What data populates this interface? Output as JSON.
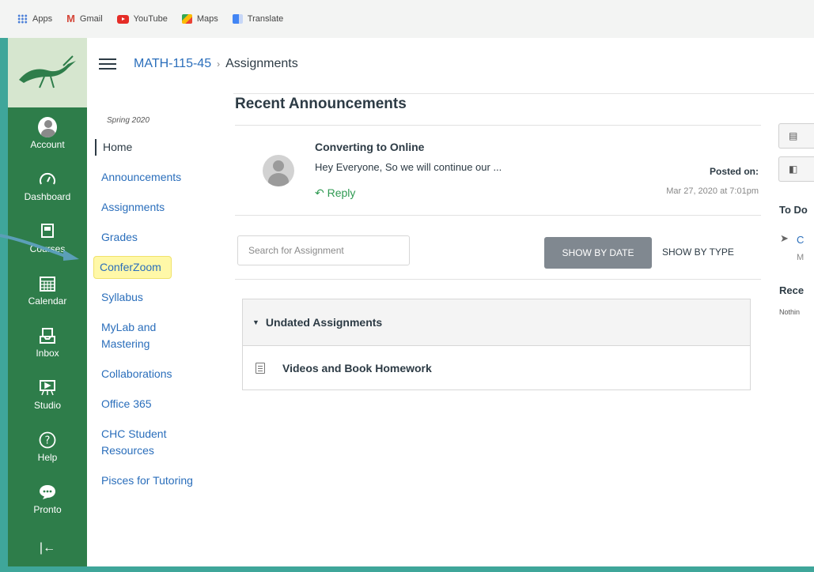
{
  "bookmarks": {
    "items": [
      {
        "label": "Apps",
        "icon": "apps-grid-icon"
      },
      {
        "label": "Gmail",
        "icon": "gmail-icon"
      },
      {
        "label": "YouTube",
        "icon": "youtube-icon"
      },
      {
        "label": "Maps",
        "icon": "maps-icon"
      },
      {
        "label": "Translate",
        "icon": "translate-icon"
      }
    ]
  },
  "global_nav": {
    "account": "Account",
    "dashboard": "Dashboard",
    "courses": "Courses",
    "calendar": "Calendar",
    "inbox": "Inbox",
    "studio": "Studio",
    "help": "Help",
    "pronto": "Pronto",
    "collapse_glyph": "|←"
  },
  "breadcrumb": {
    "course": "MATH-115-45",
    "separator": "›",
    "current": "Assignments"
  },
  "course_nav": {
    "term": "Spring 2020",
    "home": "Home",
    "announcements": "Announcements",
    "assignments": "Assignments",
    "grades": "Grades",
    "conferzoom": "ConferZoom",
    "syllabus": "Syllabus",
    "mylab": "MyLab and Mastering",
    "collaborations": "Collaborations",
    "office365": "Office 365",
    "chc": "CHC Student Resources",
    "pisces": "Pisces for Tutoring"
  },
  "announcements": {
    "heading": "Recent Announcements",
    "subject": "Converting to Online",
    "message": "Hey Everyone, So we will continue our ...",
    "reply": "↶ Reply",
    "posted_label": "Posted on:",
    "posted_date": "Mar 27, 2020 at 7:01pm"
  },
  "toolbar": {
    "search_placeholder": "Search for Assignment",
    "show_by_date": "SHOW BY DATE",
    "show_by_type": "SHOW BY TYPE"
  },
  "assignment_group": {
    "title": "Undated Assignments",
    "items": [
      "Videos and Book Homework"
    ]
  },
  "right_sidebar": {
    "todo_heading": "To Do",
    "todo_link": "C",
    "todo_sub": "M",
    "recent_heading": "Rece",
    "nothing": "Nothin"
  },
  "colors": {
    "page_bg": "#3fa69a",
    "global_nav": "#2e7d4a",
    "link": "#2a6ebb",
    "reply": "#2f9a52",
    "highlight": "#fff8a8",
    "button": "#808890"
  }
}
